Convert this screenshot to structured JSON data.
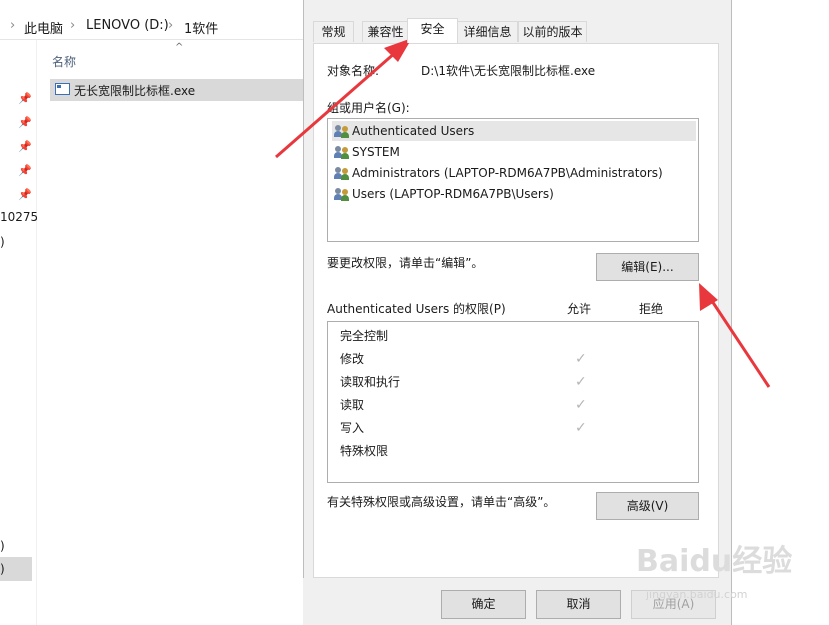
{
  "explorer": {
    "breadcrumb": [
      "此电脑",
      "LENOVO (D:)",
      "1软件"
    ],
    "column_header": "名称",
    "file_name": "无长宽限制比标框.exe",
    "left_fragments": [
      "10275",
      ")",
      ")",
      ")"
    ]
  },
  "dialog": {
    "tabs": [
      "常规",
      "兼容性",
      "安全",
      "详细信息",
      "以前的版本"
    ],
    "active_tab": "安全",
    "object_name_label": "对象名称:",
    "object_name_value": "D:\\1软件\\无长宽限制比标框.exe",
    "groups_label": "组或用户名(G):",
    "users": [
      "Authenticated Users",
      "SYSTEM",
      "Administrators (LAPTOP-RDM6A7PB\\Administrators)",
      "Users (LAPTOP-RDM6A7PB\\Users)"
    ],
    "change_hint": "要更改权限，请单击“编辑”。",
    "edit_button": "编辑(E)...",
    "perm_title": "Authenticated Users 的权限(P)",
    "allow_label": "允许",
    "deny_label": "拒绝",
    "permissions": [
      {
        "name": "完全控制",
        "allow": false
      },
      {
        "name": "修改",
        "allow": true
      },
      {
        "name": "读取和执行",
        "allow": true
      },
      {
        "name": "读取",
        "allow": true
      },
      {
        "name": "写入",
        "allow": true
      },
      {
        "name": "特殊权限",
        "allow": false
      }
    ],
    "advanced_hint": "有关特殊权限或高级设置，请单击“高级”。",
    "advanced_button": "高级(V)",
    "ok_button": "确定",
    "cancel_button": "取消",
    "apply_button": "应用(A)"
  },
  "watermark": {
    "brand": "Baidu经验",
    "url": "jingyan.baidu.com"
  },
  "colors": {
    "arrow": "#e8383d",
    "dialog_bg": "#f0f0f0",
    "selection": "#d9d9d9"
  }
}
